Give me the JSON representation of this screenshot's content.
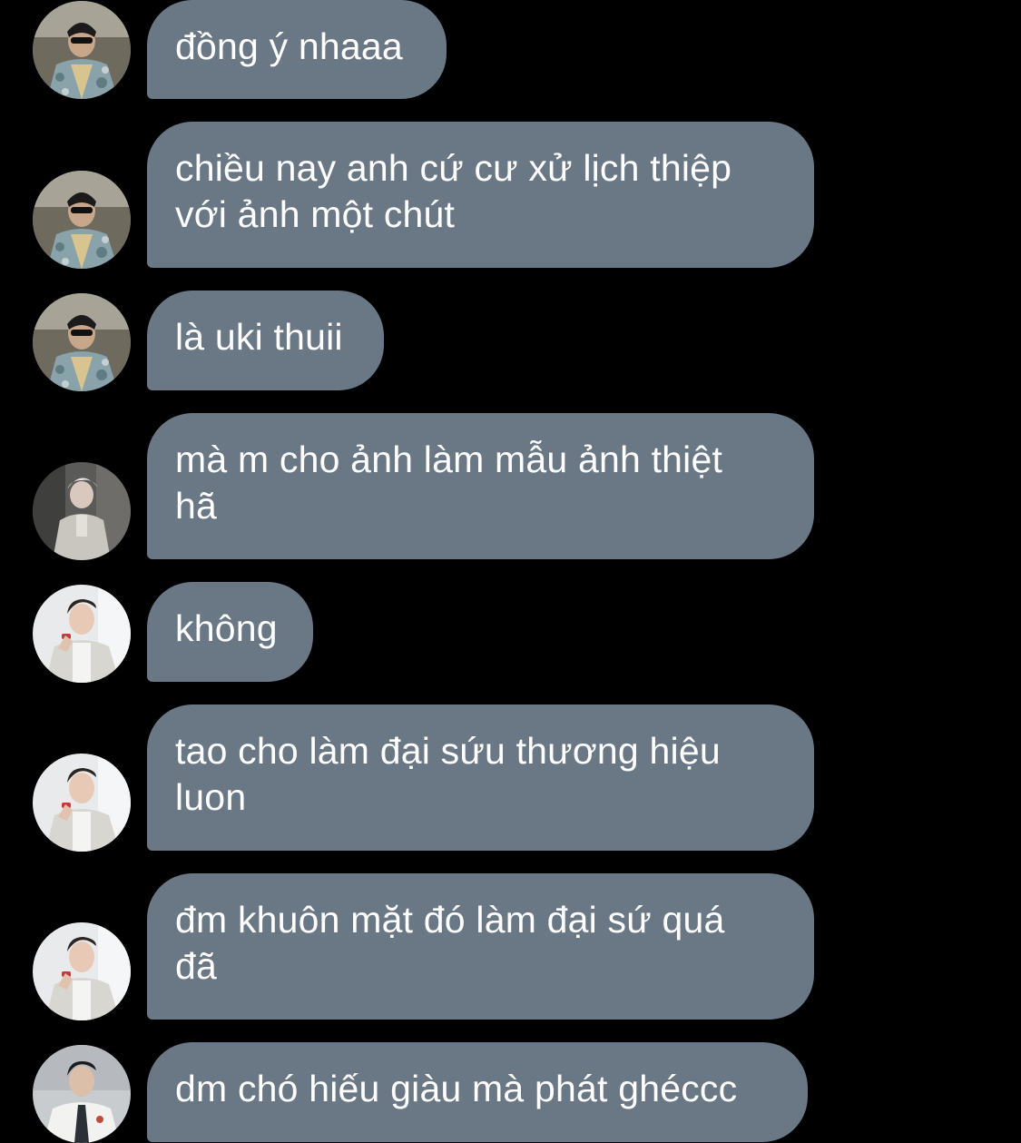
{
  "messages": [
    {
      "text": "đồng ý nhaaa",
      "avatar": "avatar-photo-camo-jacket"
    },
    {
      "text": "chiều nay anh cứ cư xử lịch thiệp\nvới ảnh một chút",
      "avatar": "avatar-photo-camo-jacket"
    },
    {
      "text": "là uki thuii",
      "avatar": "avatar-photo-camo-jacket"
    },
    {
      "text": "mà m cho ảnh làm mẫu ảnh thiệt\nhã",
      "avatar": "avatar-photo-silver-hair"
    },
    {
      "text": "không",
      "avatar": "avatar-photo-white-jacket"
    },
    {
      "text": "tao cho làm đại sứu thương hiệu\nluon",
      "avatar": "avatar-photo-white-jacket"
    },
    {
      "text": "đm khuôn mặt đó làm đại sứ quá\nđã",
      "avatar": "avatar-photo-white-jacket"
    },
    {
      "text": "dm chó hiếu giàu mà phát ghéccc",
      "avatar": "avatar-photo-white-shirt"
    }
  ],
  "colors": {
    "background": "#000000",
    "bubble": "#6a7785",
    "bubble_text": "#ffffff"
  }
}
